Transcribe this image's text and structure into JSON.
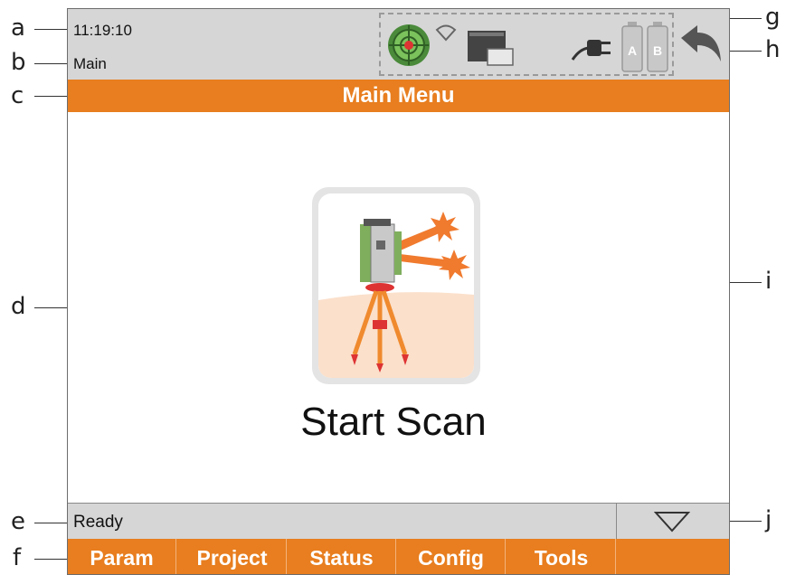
{
  "callouts": [
    "a",
    "b",
    "c",
    "d",
    "e",
    "f",
    "g",
    "h",
    "i",
    "j"
  ],
  "header": {
    "time": "11:19:10",
    "screen_name": "Main",
    "status_icons": [
      "level-bubble-icon",
      "wifi-icon",
      "memory-card-icon",
      "power-plug-icon",
      "battery-a-icon",
      "battery-b-icon"
    ],
    "battery_a_label": "A",
    "battery_b_label": "B",
    "back_icon": "back-arrow-icon"
  },
  "title_bar": {
    "title": "Main Menu"
  },
  "main": {
    "tile": {
      "icon": "scanner-tripod-icon",
      "label": "Start Scan"
    }
  },
  "status_bar": {
    "message": "Ready",
    "expand_icon": "triangle-down-icon"
  },
  "softkeys": [
    {
      "label": "Param"
    },
    {
      "label": "Project"
    },
    {
      "label": "Status"
    },
    {
      "label": "Config"
    },
    {
      "label": "Tools"
    },
    {
      "label": ""
    }
  ],
  "colors": {
    "accent_orange": "#e87e1f",
    "bar_gray": "#d6d6d6",
    "tile_gray": "#e4e4e4",
    "ground_peach": "#fbe0cb"
  }
}
